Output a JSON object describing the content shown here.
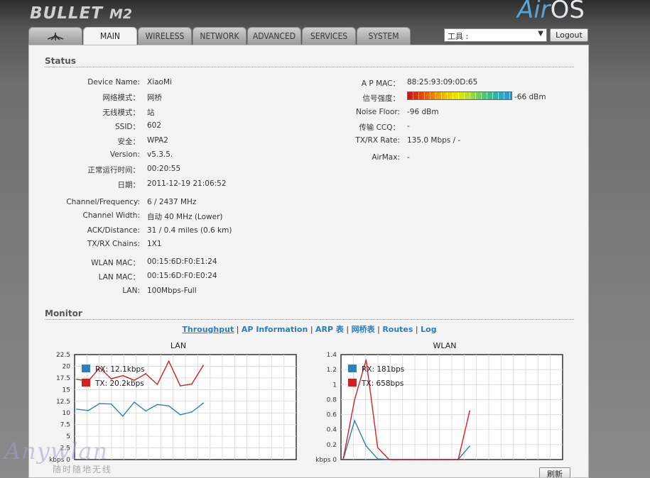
{
  "brand": {
    "product": "BULLET",
    "model": "M2",
    "os_prefix": "Air",
    "os_suffix": "OS"
  },
  "tabs": [
    {
      "label": "",
      "icon": "ubiquiti-logo-icon"
    },
    {
      "label": "MAIN"
    },
    {
      "label": "WIRELESS"
    },
    {
      "label": "NETWORK"
    },
    {
      "label": "ADVANCED"
    },
    {
      "label": "SERVICES"
    },
    {
      "label": "SYSTEM"
    }
  ],
  "active_tab": "MAIN",
  "toolbar": {
    "tools_value": "工具 :",
    "logout_label": "Logout"
  },
  "status": {
    "title": "Status",
    "left": [
      {
        "label": "Device Name:",
        "value": "XiaoMi"
      },
      {
        "label": "网络模式：",
        "value": "网桥"
      },
      {
        "label": "无线模式：",
        "value": "站"
      },
      {
        "label": "SSID：",
        "value": "602"
      },
      {
        "label": "安全：",
        "value": "WPA2"
      },
      {
        "label": "Version:",
        "value": "v5.3.5."
      },
      {
        "label": "正常运行时间：",
        "value": "00:20:55"
      },
      {
        "label": "日期：",
        "value": "2011-12-19 21:06:52"
      },
      {
        "label": "Channel/Frequency:",
        "value": "6 / 2437 MHz"
      },
      {
        "label": "Channel Width:",
        "value": "自动 40 MHz (Lower)"
      },
      {
        "label": "ACK/Distance:",
        "value": "31 / 0.4 miles (0.6 km)"
      },
      {
        "label": "TX/RX Chains:",
        "value": "1X1"
      },
      {
        "label": "WLAN MAC：",
        "value": "00:15:6D:F0:E1:24"
      },
      {
        "label": "LAN MAC：",
        "value": "00:15:6D:F0:E0:24"
      },
      {
        "label": "LAN:",
        "value": "100Mbps-Full"
      }
    ],
    "right": [
      {
        "label": "A P MAC：",
        "value": "88:25:93:09:0D:65"
      },
      {
        "label": "信号强度：",
        "value": "-66 dBm"
      },
      {
        "label": "Noise Floor:",
        "value": "-96 dBm"
      },
      {
        "label": "传输 CCQ：",
        "value": "-"
      },
      {
        "label": "TX/RX Rate:",
        "value": "135.0 Mbps / -"
      },
      {
        "label": "AirMax:",
        "value": "-"
      }
    ]
  },
  "monitor": {
    "title": "Monitor",
    "links": [
      "Throughput",
      "AP Information",
      "ARP 表",
      "网桥表",
      "Routes",
      "Log"
    ],
    "refresh_label": "刷新"
  },
  "watermark": {
    "text": "Anywlan",
    "sub": "随时随地无线"
  },
  "colors": {
    "rx": "#2f7fb8",
    "tx": "#d32020",
    "link": "#2a7bbf"
  },
  "chart_data": [
    {
      "type": "line",
      "title": "LAN",
      "ylabel": "kbps",
      "ylim": [
        0,
        22.5
      ],
      "yticks": [
        "0",
        "2.5",
        "5",
        "7.5",
        "10",
        "12.5",
        "15",
        "17.5",
        "20",
        "22.5"
      ],
      "grid": true,
      "legend_position": "top-left",
      "series": [
        {
          "name": "RX: 12.1kbps",
          "values": [
            10.8,
            10.5,
            12.0,
            11.9,
            9.3,
            12.3,
            10.4,
            11.8,
            11.5,
            9.6,
            10.2,
            12.1
          ]
        },
        {
          "name": "TX: 20.2kbps",
          "values": [
            17.2,
            16.8,
            19.7,
            17.3,
            18.0,
            17.0,
            18.4,
            16.1,
            21.1,
            15.8,
            16.2,
            20.2
          ]
        }
      ]
    },
    {
      "type": "line",
      "title": "WLAN",
      "ylabel": "kbps",
      "ylim": [
        0,
        1.4
      ],
      "yticks": [
        "0",
        "0.2",
        "0.4",
        "0.6",
        "0.8",
        "1",
        "1.2",
        "1.4"
      ],
      "grid": true,
      "legend_position": "top-left",
      "series": [
        {
          "name": "RX: 181bps",
          "values": [
            0.0,
            0.52,
            0.18,
            0.01,
            0.0,
            0.0,
            0.0,
            0.0,
            0.0,
            0.0,
            0.0,
            0.18
          ]
        },
        {
          "name": "TX: 658bps",
          "values": [
            0.0,
            0.8,
            1.33,
            0.16,
            0.0,
            0.0,
            0.0,
            0.0,
            0.0,
            0.0,
            0.0,
            0.65
          ]
        }
      ]
    }
  ]
}
